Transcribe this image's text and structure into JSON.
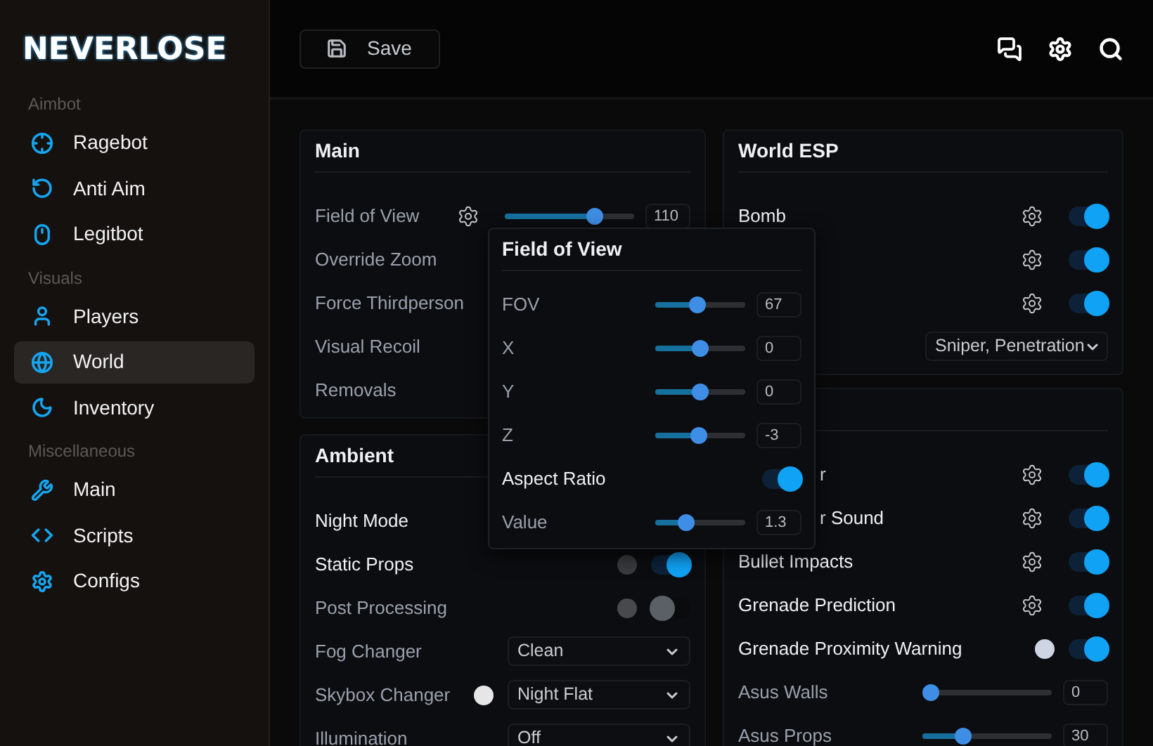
{
  "logo": "NEVERLOSE",
  "sidebar": {
    "sections": [
      {
        "title": "Aimbot",
        "items": [
          {
            "label": "Ragebot",
            "selected": false
          },
          {
            "label": "Anti Aim",
            "selected": false
          },
          {
            "label": "Legitbot",
            "selected": false
          }
        ]
      },
      {
        "title": "Visuals",
        "items": [
          {
            "label": "Players",
            "selected": false
          },
          {
            "label": "World",
            "selected": true
          },
          {
            "label": "Inventory",
            "selected": false
          }
        ]
      },
      {
        "title": "Miscellaneous",
        "items": [
          {
            "label": "Main",
            "selected": false
          },
          {
            "label": "Scripts",
            "selected": false
          },
          {
            "label": "Configs",
            "selected": false
          }
        ]
      }
    ]
  },
  "toolbar": {
    "save_button": "Save"
  },
  "columns": [
    [
      {
        "title": "Main",
        "rows": [
          {
            "label": "Field of View",
            "active": false,
            "gear": true,
            "control": {
              "kind": "slider",
              "level": 0.73,
              "value": "110"
            }
          },
          {
            "label": "Override Zoom",
            "active": false
          },
          {
            "label": "Force Thirdperson",
            "active": false
          },
          {
            "label": "Visual Recoil",
            "active": false
          },
          {
            "label": "Removals",
            "active": false
          }
        ]
      },
      {
        "title": "Ambient",
        "rows": [
          {
            "label": "Night Mode",
            "active": true
          },
          {
            "label": "Static Props",
            "active": true,
            "color": "#3a3b3e",
            "control": {
              "kind": "toggle",
              "on": true
            }
          },
          {
            "label": "Post Processing",
            "active": false,
            "color": "#48494c",
            "control": {
              "kind": "toggle",
              "on": false
            }
          },
          {
            "label": "Fog Changer",
            "active": false,
            "control": {
              "kind": "select",
              "value": "Clean"
            }
          },
          {
            "label": "Skybox Changer",
            "active": false,
            "color": "#e6e6e6",
            "control": {
              "kind": "select",
              "value": "Night Flat"
            }
          },
          {
            "label": "Illumination",
            "active": false,
            "control": {
              "kind": "select",
              "value": "Off"
            }
          }
        ]
      }
    ],
    [
      {
        "title": "World ESP",
        "rows": [
          {
            "label": "Bomb",
            "active": true,
            "gear": true,
            "control": {
              "kind": "toggle",
              "on": true
            }
          },
          {
            "gear": true,
            "control": {
              "kind": "toggle",
              "on": true
            }
          },
          {
            "gear": true,
            "control": {
              "kind": "toggle",
              "on": true
            }
          },
          {
            "control": {
              "kind": "select",
              "value": "Sniper, Penetration"
            }
          }
        ]
      },
      {
        "rows": [
          {
            "label": "r",
            "active": true,
            "partly_covered": true,
            "gear": true,
            "control": {
              "kind": "toggle",
              "on": true
            }
          },
          {
            "label": "r Sound",
            "active": true,
            "partly_covered": true,
            "gear": true,
            "control": {
              "kind": "toggle",
              "on": true
            }
          },
          {
            "label": "Bullet Impacts",
            "active": true,
            "gear": true,
            "control": {
              "kind": "toggle",
              "on": true
            }
          },
          {
            "label": "Grenade Prediction",
            "active": true,
            "gear": true,
            "control": {
              "kind": "toggle",
              "on": true
            }
          },
          {
            "label": "Grenade Proximity Warning",
            "active": true,
            "color": "#cfd6e3",
            "control": {
              "kind": "toggle",
              "on": true
            }
          },
          {
            "label": "Asus Walls",
            "active": false,
            "control": {
              "kind": "slider",
              "level": 0,
              "value": "0"
            }
          },
          {
            "label": "Asus Props",
            "active": false,
            "control": {
              "kind": "slider",
              "level": 0.29,
              "value": "30"
            }
          }
        ]
      }
    ]
  ],
  "popup": {
    "title": "Field of View",
    "rows": [
      {
        "label": "FOV",
        "active": false,
        "control": {
          "kind": "slider",
          "level": 0.47,
          "value": "67"
        }
      },
      {
        "label": "X",
        "active": false,
        "control": {
          "kind": "slider",
          "level": 0.5,
          "value": "0"
        }
      },
      {
        "label": "Y",
        "active": false,
        "control": {
          "kind": "slider",
          "level": 0.5,
          "value": "0"
        }
      },
      {
        "label": "Z",
        "active": false,
        "control": {
          "kind": "slider",
          "level": 0.48,
          "value": "-3"
        }
      },
      {
        "label": "Aspect Ratio",
        "active": true,
        "control": {
          "kind": "toggle",
          "on": true
        }
      },
      {
        "label": "Value",
        "active": false,
        "control": {
          "kind": "slider",
          "level": 0.3,
          "value": "1.3"
        }
      }
    ]
  }
}
